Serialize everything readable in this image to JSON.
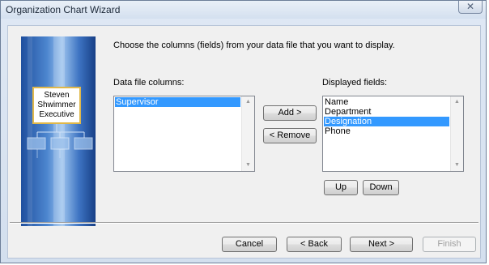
{
  "window": {
    "title": "Organization Chart Wizard",
    "close_glyph": "✕"
  },
  "banner": {
    "box_lines": [
      "Steven",
      "Shwimmer",
      "Executive"
    ]
  },
  "main": {
    "prompt": "Choose the columns (fields) from your data file that you want to display.",
    "data_file_columns_label": "Data file columns:",
    "displayed_fields_label": "Displayed fields:"
  },
  "data_file_columns": [
    {
      "label": "Supervisor",
      "selected": true
    }
  ],
  "displayed_fields": [
    {
      "label": "Name",
      "selected": false
    },
    {
      "label": "Department",
      "selected": false
    },
    {
      "label": "Designation",
      "selected": true
    },
    {
      "label": "Phone",
      "selected": false
    }
  ],
  "buttons": {
    "add": "Add >",
    "remove": "< Remove",
    "up": "Up",
    "down": "Down",
    "cancel": "Cancel",
    "back": "< Back",
    "next": "Next >",
    "finish": "Finish"
  },
  "colors": {
    "selection": "#3399ff",
    "banner_blue": "#2d62b3",
    "box_border": "#e0b84a"
  },
  "icons": {
    "scroll_up": "▲",
    "scroll_down": "▼"
  }
}
